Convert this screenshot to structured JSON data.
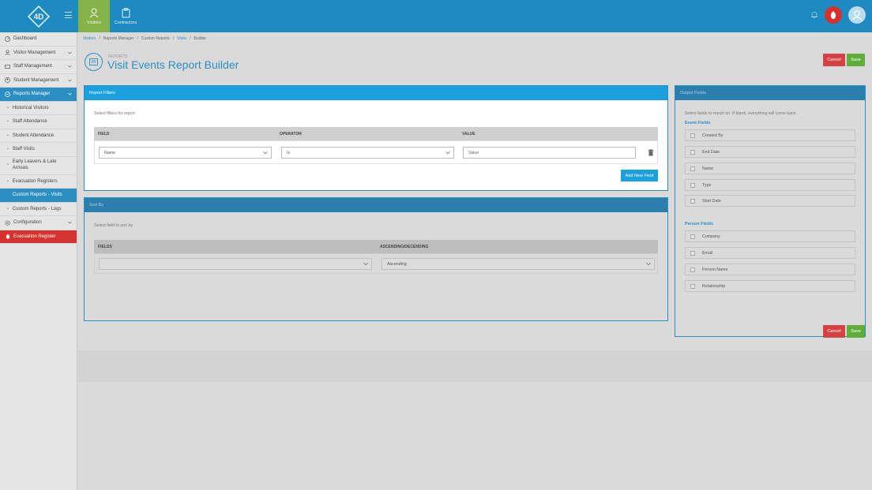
{
  "topbar": {
    "logo_text": "4D",
    "tabs": [
      {
        "label": "Visitors",
        "icon": "visitor-icon"
      },
      {
        "label": "Contractors",
        "icon": "clipboard-icon"
      }
    ]
  },
  "sidebar": {
    "items": [
      {
        "label": "Dashboard",
        "icon": "dashboard-icon"
      },
      {
        "label": "Visitor Management",
        "icon": "user-icon"
      },
      {
        "label": "Staff Management",
        "icon": "id-card-icon"
      },
      {
        "label": "Student Management",
        "icon": "student-icon"
      },
      {
        "label": "Reports Manager",
        "icon": "reports-icon"
      },
      {
        "label": "Historical Visitors"
      },
      {
        "label": "Staff Attendance"
      },
      {
        "label": "Student Attendance"
      },
      {
        "label": "Staff Visits"
      },
      {
        "label": "Early Leavers & Late Arrivals"
      },
      {
        "label": "Evacuation Registers"
      },
      {
        "label": "Custom Reports - Visits"
      },
      {
        "label": "Custom Reports - Logs"
      },
      {
        "label": "Configuration",
        "icon": "gear-icon"
      },
      {
        "label": "Evacuation Register",
        "icon": "fire-icon"
      }
    ]
  },
  "breadcrumb": [
    "Visitors",
    "Reports Manager",
    "Custom Reports",
    "Visits",
    "Builder"
  ],
  "page": {
    "pretitle": "REPORTS",
    "title": "Visit Events Report Builder",
    "cancel": "Cancel",
    "save": "Save"
  },
  "filters": {
    "header": "Report Filters",
    "hint": "Select filters for report",
    "col_field": "FIELD",
    "col_operator": "OPERATOR",
    "col_value": "VALUE",
    "field_value": "Name",
    "operator_value": "Is",
    "value_placeholder": "Value",
    "add_button": "Add New Field"
  },
  "sort": {
    "header": "Sort By",
    "hint": "Select field to sort by",
    "col_fields": "FIELDS",
    "col_order": "ASCENDING/DECENDING",
    "field_value": "",
    "order_value": "Ascending"
  },
  "output": {
    "header": "Output Fields",
    "hint": "Select fields to report on. If blank, everything will come back.",
    "event_title": "Event Fields",
    "event_fields": [
      "Created By",
      "End Date",
      "Name",
      "Type",
      "Start Date"
    ],
    "person_title": "Person Fields",
    "person_fields": [
      "Company",
      "Email",
      "Person Name",
      "Relationship"
    ]
  },
  "colors": {
    "primary": "#1aa0dc",
    "cancel": "#d34343",
    "save": "#5fae3a",
    "active_tab": "#86b24a"
  }
}
